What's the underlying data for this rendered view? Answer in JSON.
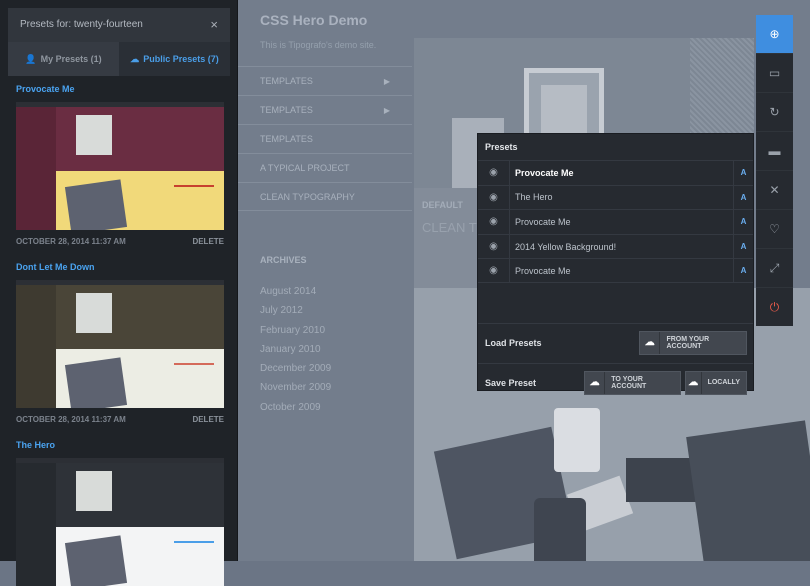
{
  "site": {
    "title": "CSS Hero Demo",
    "description": "This is Tipografo's demo site.",
    "nav": [
      "TEMPLATES",
      "TEMPLATES",
      "TEMPLATES",
      "A TYPICAL PROJECT",
      "CLEAN TYPOGRAPHY"
    ],
    "archives_title": "ARCHIVES",
    "archives": [
      "August 2014",
      "July 2012",
      "February 2010",
      "January 2010",
      "December 2009",
      "November 2009",
      "October 2009"
    ],
    "post_category": "DEFAULT",
    "post_title": "CLEAN T"
  },
  "sidebar": {
    "header": "Presets for: twenty-fourteen",
    "close": "×",
    "tabs": {
      "my": "My Presets (1)",
      "public": "Public Presets (7)"
    },
    "presets": [
      {
        "name": "Provocate Me",
        "date": "OCTOBER 28, 2014 11:37 AM",
        "delete": "DELETE"
      },
      {
        "name": "Dont Let Me Down",
        "date": "OCTOBER 28, 2014 11:37 AM",
        "delete": "DELETE"
      },
      {
        "name": "The Hero"
      }
    ]
  },
  "panel": {
    "title": "Presets",
    "rows": [
      {
        "name": "Provocate Me",
        "flag": "A"
      },
      {
        "name": "The Hero",
        "flag": "A"
      },
      {
        "name": "Provocate Me",
        "flag": "A"
      },
      {
        "name": "2014 Yellow Background!",
        "flag": "A"
      },
      {
        "name": "Provocate Me",
        "flag": "A"
      }
    ],
    "load_label": "Load Presets",
    "load_button": "FROM YOUR ACCOUNT",
    "save_label": "Save Preset",
    "save_account_button": "TO YOUR ACCOUNT",
    "save_local_button": "LOCALLY"
  },
  "colors": {
    "accent": "#3f8ee0",
    "link": "#4aa3f0",
    "power": "#e55a4a",
    "thumb1_main": "#6a2d42",
    "thumb1_bottom": "#f1d97a",
    "thumb2_main": "#4a4538",
    "thumb2_bottom": "#ecede4",
    "thumb3_main": "#2e3238",
    "thumb3_bottom": "#f3f4f5"
  },
  "icons": {
    "rail": [
      "crosshair-icon",
      "monitor-icon",
      "refresh-icon",
      "folder-icon",
      "tools-icon",
      "heart-icon",
      "expand-icon",
      "power-icon"
    ],
    "eye": "eye-icon",
    "cloud_up": "cloud-upload-icon",
    "cloud_down": "cloud-download-icon"
  }
}
